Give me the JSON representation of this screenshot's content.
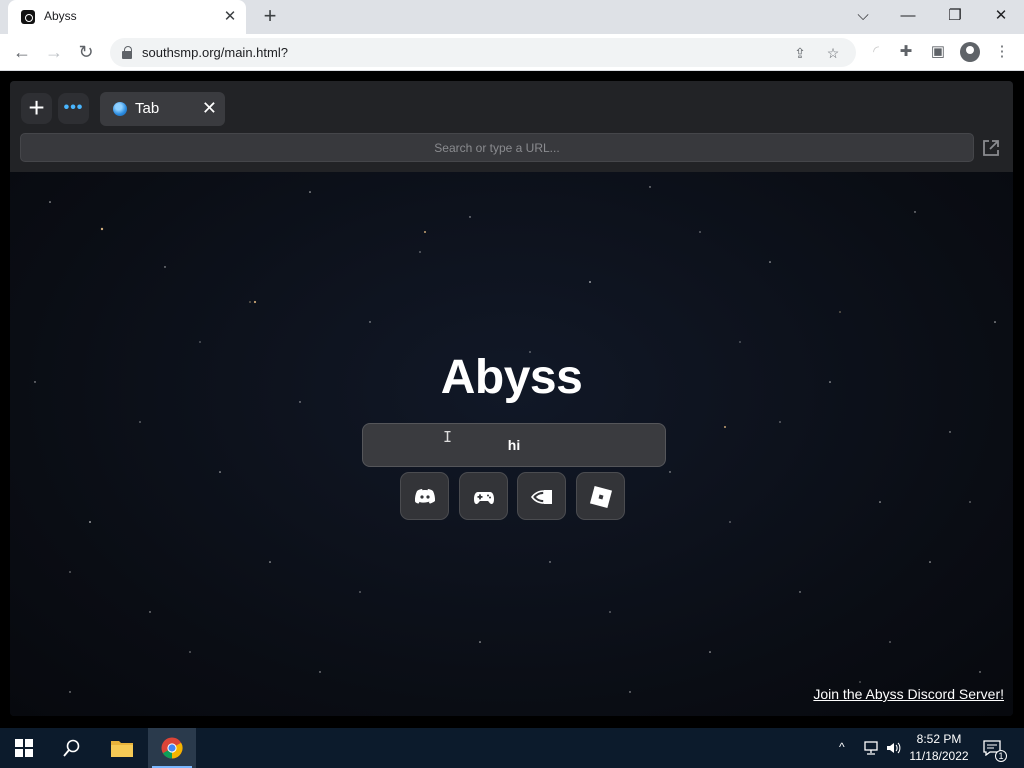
{
  "browser": {
    "tab_title": "Abyss",
    "tab_close": "✕",
    "new_tab": "+",
    "url": "southsmp.org/main.html?",
    "window_controls": {
      "chevron": "⌵",
      "minimize": "—",
      "restore": "❐",
      "close": "✕"
    }
  },
  "app": {
    "plus_label": "+",
    "menu_label": "•••",
    "tab_label": "Tab",
    "tab_close": "✕",
    "url_placeholder": "Search or type a URL...",
    "title": "Abyss",
    "search_value": "hi",
    "quick_links": [
      {
        "name": "Discord",
        "icon": "discord-icon"
      },
      {
        "name": "Games",
        "icon": "gamepad-icon"
      },
      {
        "name": "GeForce NOW",
        "icon": "nvidia-icon"
      },
      {
        "name": "Roblox",
        "icon": "roblox-icon"
      }
    ],
    "discord_link": "Join the Abyss Discord Server!"
  },
  "taskbar": {
    "time": "8:52 PM",
    "date": "11/18/2022",
    "notification_count": "1",
    "tray_chevron": "^"
  },
  "colors": {
    "accent": "#49b6ff",
    "app_bg": "#0b0f17",
    "topbar": "#222326"
  }
}
